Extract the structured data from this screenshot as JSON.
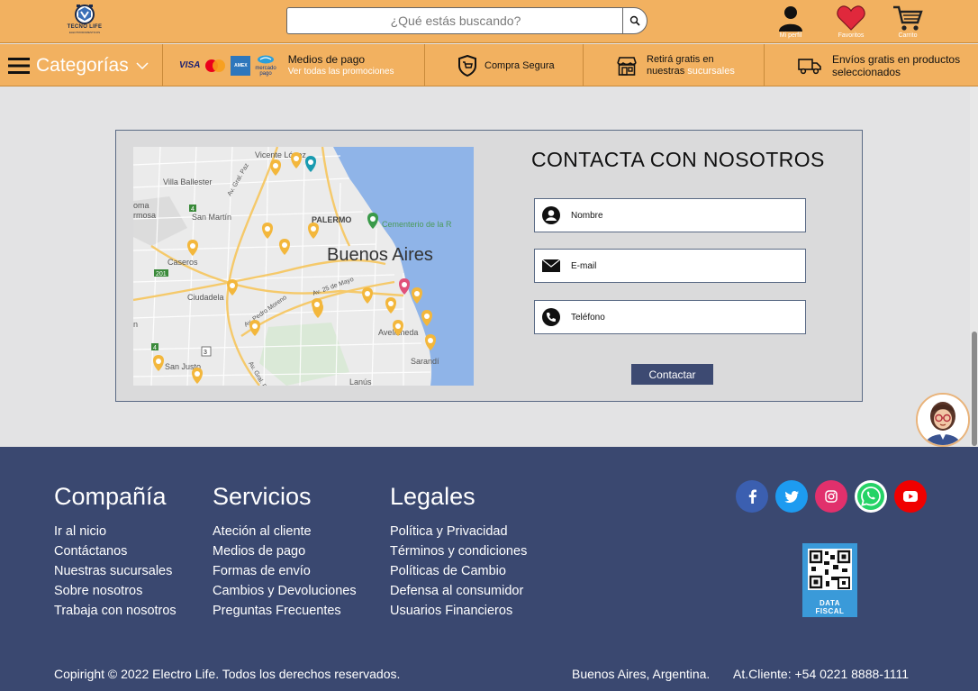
{
  "header": {
    "logo_text": "TECNO LIFE",
    "logo_subtext": "ELECTRODOMESTICOS",
    "search_placeholder": "¿Qué estás buscando?",
    "profile_label": "Mi perfil",
    "favorites_label": "Favoritos",
    "cart_label": "Carrito"
  },
  "infobar": {
    "categories_label": "Categorías",
    "card_brands": [
      "VISA",
      "mastercard",
      "AMERICAN EXPRESS",
      "mercado pago"
    ],
    "payment_title": "Medios de pago",
    "payment_subtitle": "Ver todas las promociones",
    "secure_label": "Compra Segura",
    "pickup_line1": "Retirá gratis en",
    "pickup_line2_prefix": "nuestras ",
    "pickup_line2_highlight": "sucursales",
    "shipping_line1": "Envíos gratis en productos",
    "shipping_line2": "seleccionados"
  },
  "map": {
    "city_label": "Buenos Aires",
    "places": [
      "Vicente López",
      "Villa Ballester",
      "San Martín",
      "PALERMO",
      "Cementerio de la Recoleta",
      "Caseros",
      "Ciudadela",
      "Av. 25 de Mayo",
      "Av. Pedro Moreno",
      "Avellaneda",
      "Sarandí",
      "San Justo",
      "Lanús",
      "Av. Gral. Paz",
      "Morón"
    ],
    "road_numbers": [
      "4",
      "201",
      "3",
      "4",
      "7",
      "4"
    ]
  },
  "contact": {
    "title": "CONTACTA CON NOSOTROS",
    "name_label": "Nombre",
    "email_label": "E-mail",
    "phone_label": "Teléfono",
    "submit_label": "Contactar"
  },
  "footer": {
    "company": {
      "title": "Compañía",
      "links": [
        "Ir al nicio",
        "Contáctanos",
        "Nuestras sucursales",
        "Sobre nosotros",
        "Trabaja con nosotros"
      ]
    },
    "services": {
      "title": "Servicios",
      "links": [
        "Ateción al cliente",
        "Medios de pago",
        "Formas de envío",
        "Cambios y Devoluciones",
        "Preguntas Frecuentes"
      ]
    },
    "legal": {
      "title": "Legales",
      "links": [
        "Política y Privacidad",
        "Términos y condiciones",
        "Políticas de Cambio",
        "Defensa al consumidor",
        "Usuarios Financieros"
      ]
    },
    "social_icons": [
      "facebook-icon",
      "twitter-icon",
      "instagram-icon",
      "whatsapp-icon",
      "youtube-icon"
    ],
    "data_fiscal_label_1": "DATA",
    "data_fiscal_label_2": "FISCAL",
    "copyright": "Copiright © 2022 Electro Life.  Todos los derechos reservados.",
    "location": "Buenos Aires, Argentina.",
    "customer_service": "At.Cliente: +54 0221 8888-1111"
  },
  "colors": {
    "header_bg": "#f2b160",
    "footer_bg": "#3a4870",
    "button_bg": "#3d4a72",
    "page_bg": "#e3e3e4"
  }
}
